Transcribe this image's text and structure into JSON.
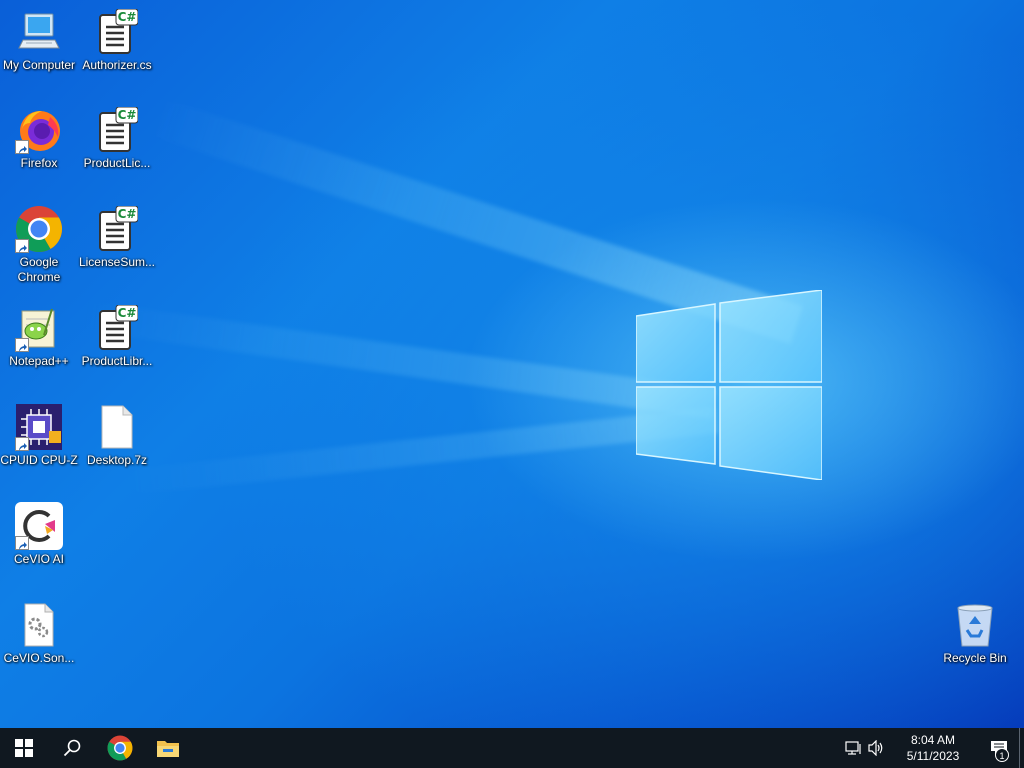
{
  "desktop": {
    "icons": [
      {
        "label": "My Computer",
        "icon": "computer-icon"
      },
      {
        "label": "Authorizer.cs",
        "icon": "csharp-file-icon"
      },
      {
        "label": "Firefox",
        "icon": "firefox-icon"
      },
      {
        "label": "ProductLic...",
        "icon": "csharp-file-icon"
      },
      {
        "label": "Google Chrome",
        "icon": "chrome-icon"
      },
      {
        "label": "LicenseSum...",
        "icon": "csharp-file-icon"
      },
      {
        "label": "Notepad++",
        "icon": "notepadpp-icon"
      },
      {
        "label": "ProductLibr...",
        "icon": "csharp-file-icon"
      },
      {
        "label": "CPUID CPU-Z",
        "icon": "cpuz-icon"
      },
      {
        "label": "Desktop.7z",
        "icon": "blank-file-icon"
      },
      {
        "label": "CeVIO AI",
        "icon": "cevio-icon"
      },
      {
        "label": "CeVIO.Son...",
        "icon": "settings-file-icon"
      },
      {
        "label": "Recycle Bin",
        "icon": "recycle-bin-icon"
      }
    ]
  },
  "taskbar": {
    "start": "windows-start-icon",
    "search": "search-icon",
    "pinned": [
      "chrome-icon",
      "file-explorer-icon"
    ],
    "tray": {
      "network": "network-icon",
      "volume": "volume-icon",
      "time": "8:04 AM",
      "date": "5/11/2023",
      "notification_count": "1"
    }
  },
  "colors": {
    "taskbar_bg": "#101820",
    "wallpaper_blue": "#0c74e0",
    "label_text": "#ffffff"
  }
}
